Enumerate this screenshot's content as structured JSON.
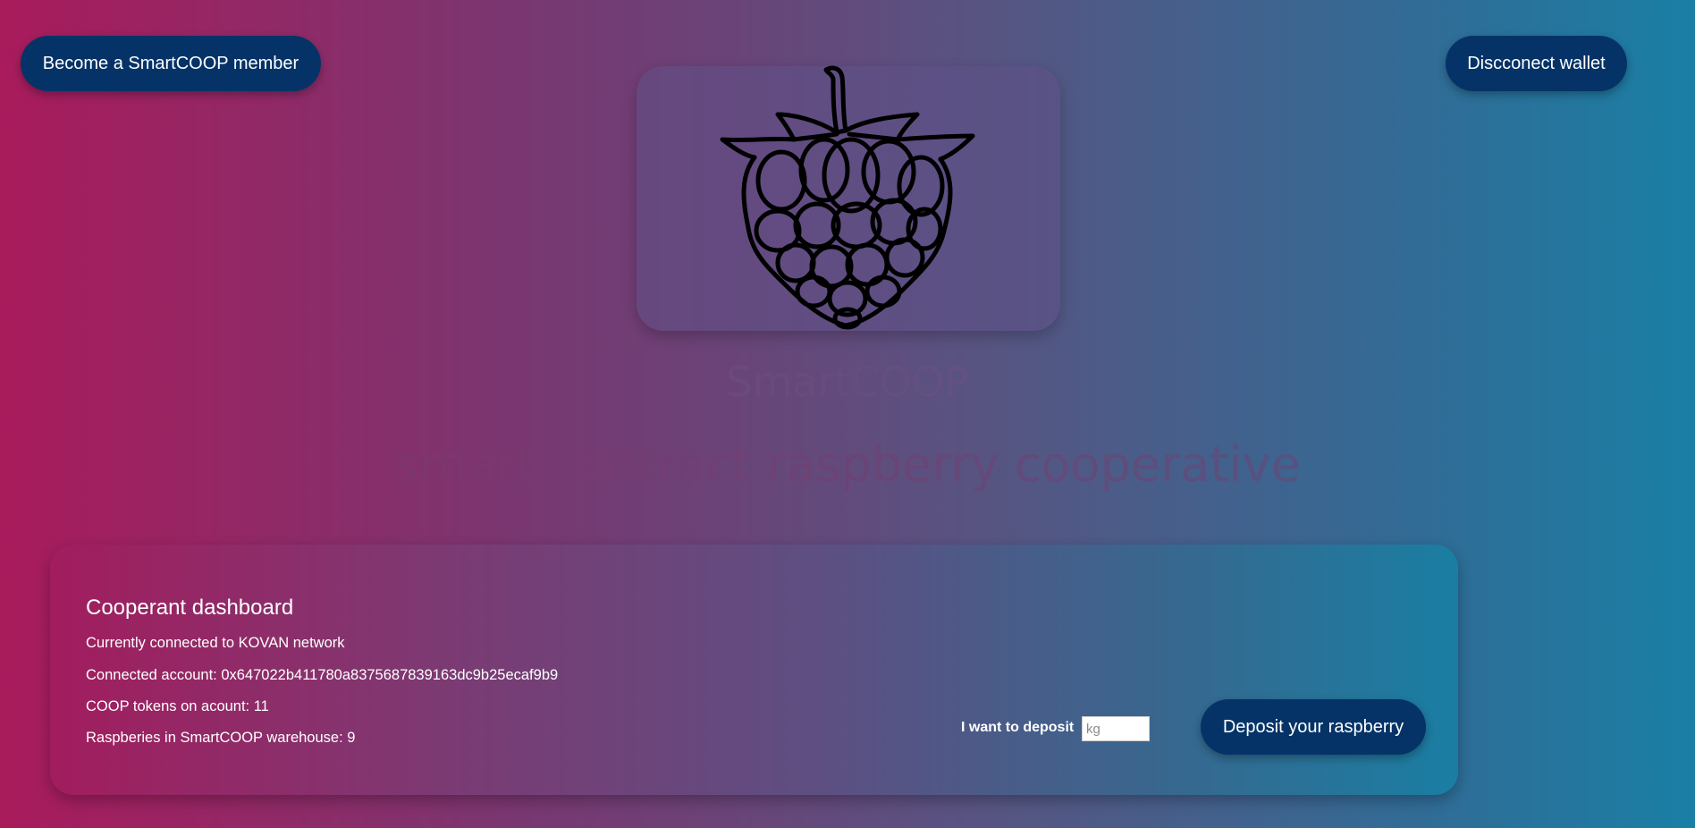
{
  "header": {
    "become_member_label": "Become a SmartCOOP member",
    "disconnect_label": "Discconect wallet"
  },
  "hero": {
    "logo_icon": "raspberry-icon",
    "brand_title": "SmartCOOP",
    "tagline": "smart contract raspberry cooperative"
  },
  "dashboard": {
    "title": "Cooperant dashboard",
    "network_line": "Currently connected to KOVAN network",
    "account_line": "Connected account: 0x647022b411780a8375687839163dc9b25ecaf9b9",
    "tokens_line": "COOP tokens on acount: 11",
    "warehouse_line": "Raspberies in SmartCOOP warehouse: 9",
    "deposit_label": "I want to deposit",
    "deposit_placeholder": "kg",
    "deposit_value": "",
    "deposit_button_label": "Deposit your raspberry"
  },
  "colors": {
    "button_bg": "#053367",
    "gradient_left": "#a91b5c",
    "gradient_right": "#1a7fa5"
  }
}
